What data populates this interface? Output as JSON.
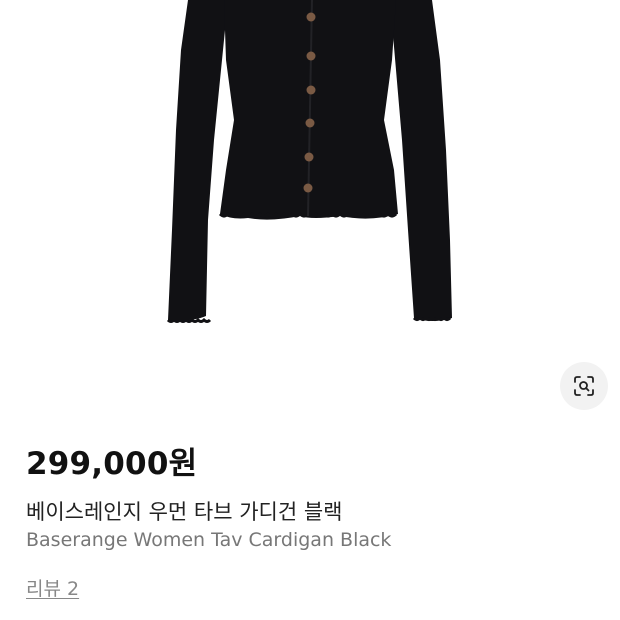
{
  "product": {
    "image_icon": "cardigan-photo",
    "lens_icon": "visual-search-icon",
    "price": "299,000원",
    "title_ko": "베이스레인지 우먼 타브 가디건 블랙",
    "title_en": "Baserange Women Tav Cardigan Black",
    "reviews_link": "리뷰 2"
  },
  "colors": {
    "garment": "#111114",
    "buttons": "#7a5a44",
    "price_text": "#111111",
    "secondary_text": "#777777",
    "lens_button_bg": "#f2f2f2"
  }
}
